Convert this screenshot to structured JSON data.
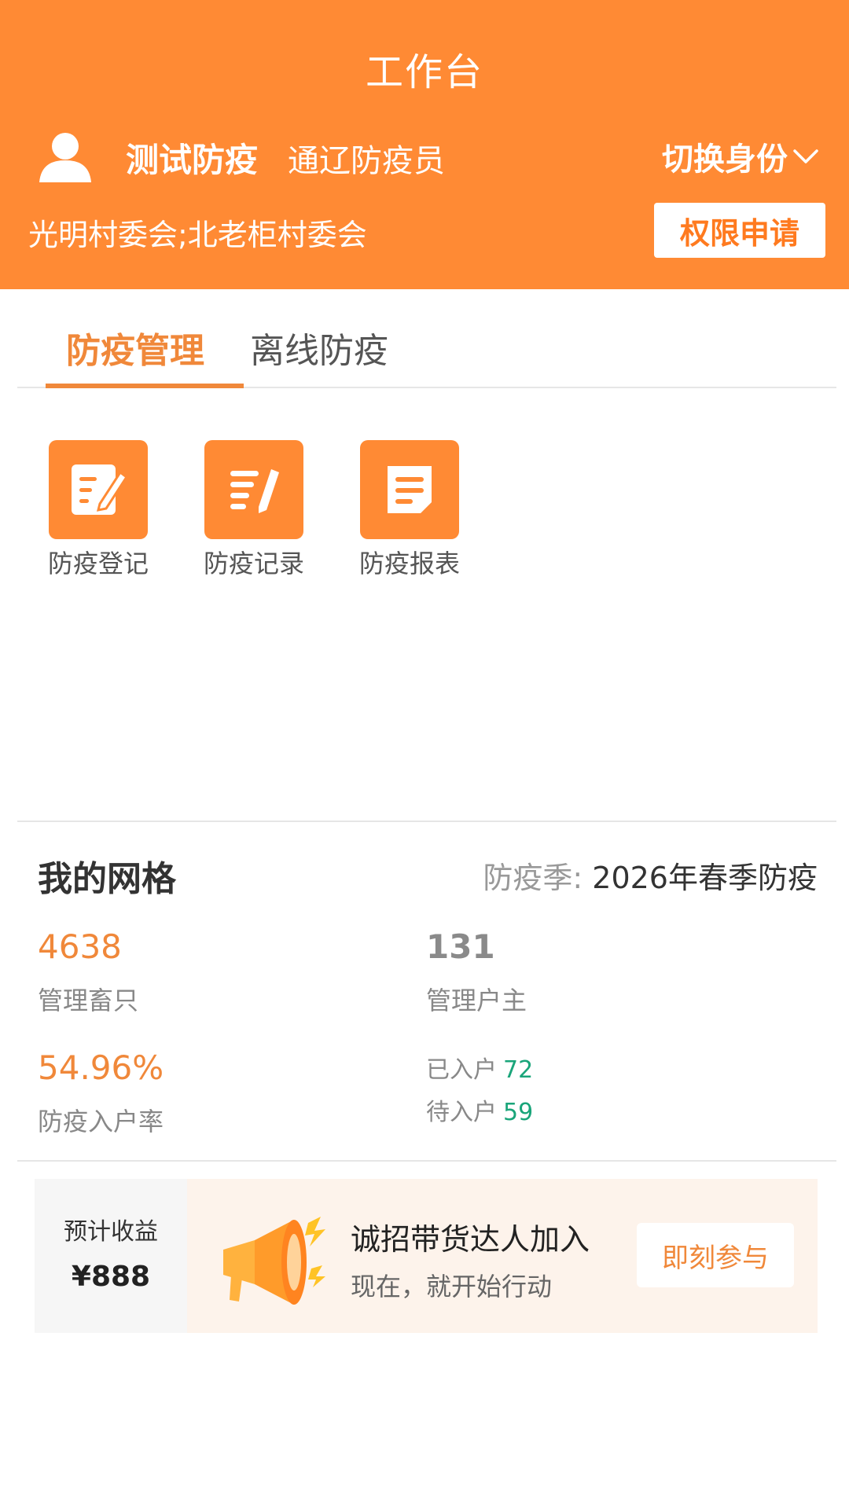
{
  "header": {
    "title": "工作台",
    "user_name": "测试防疫",
    "user_role": "通辽防疫员",
    "switch_identity": "切换身份",
    "org": "光明村委会;北老柜村委会",
    "permission_button": "权限申请"
  },
  "tabs": [
    {
      "label": "防疫管理",
      "active": true
    },
    {
      "label": "离线防疫",
      "active": false
    }
  ],
  "actions": [
    {
      "label": "防疫登记",
      "icon": "edit-form-icon"
    },
    {
      "label": "防疫记录",
      "icon": "record-list-icon"
    },
    {
      "label": "防疫报表",
      "icon": "report-icon"
    }
  ],
  "grid": {
    "title": "我的网格",
    "season_label": "防疫季:",
    "season_value": "2026年春季防疫",
    "livestock_count": "4638",
    "livestock_label": "管理畜只",
    "household_count": "131",
    "household_label": "管理户主",
    "rate": "54.96%",
    "rate_label": "防疫入户率",
    "visited_label": "已入户",
    "visited_value": "72",
    "pending_label": "待入户",
    "pending_value": "59"
  },
  "promo": {
    "earnings_label": "预计收益",
    "earnings_amount": "¥888",
    "title": "诚招带货达人加入",
    "subtitle": "现在，就开始行动",
    "button": "即刻参与"
  },
  "colors": {
    "brand_orange": "#FF8A34",
    "accent_text": "#F0883A",
    "success_green": "#1AA57A"
  }
}
